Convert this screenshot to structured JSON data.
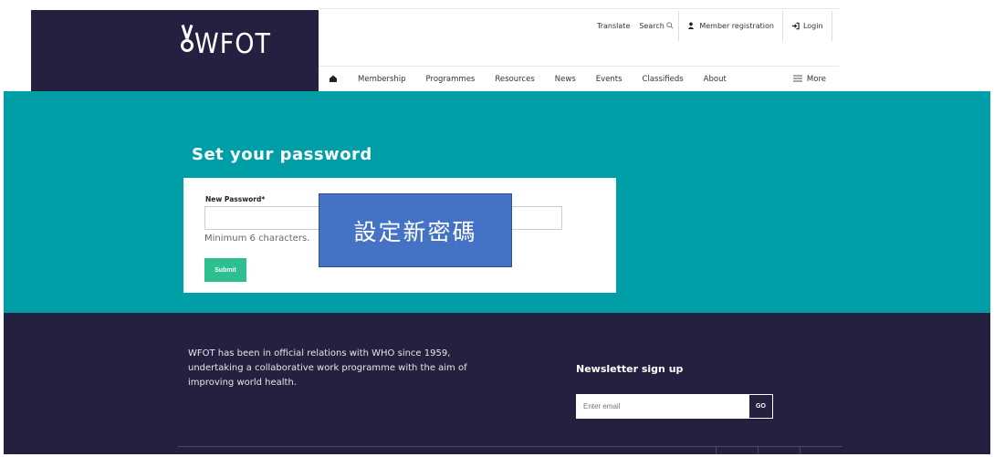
{
  "header": {
    "logo_text": "WFOT",
    "utility": {
      "translate": "Translate",
      "search": "Search",
      "member_registration": "Member registration",
      "login": "Login"
    },
    "nav": [
      "Membership",
      "Programmes",
      "Resources",
      "News",
      "Events",
      "Classifieds",
      "About"
    ],
    "more": "More"
  },
  "form": {
    "heading": "Set your password",
    "password_label": "New Password*",
    "password_value": "",
    "hint": "Minimum 6 characters.",
    "submit_label": "Submit"
  },
  "overlay": {
    "text": "設定新密碼"
  },
  "footer": {
    "about": "WFOT has been in official relations with WHO since 1959, undertaking a collaborative work programme with the aim of improving world health.",
    "newsletter_title": "Newsletter sign up",
    "email_placeholder": "Enter email",
    "go_label": "GO"
  },
  "colors": {
    "brand_dark": "#24203f",
    "teal": "#009ea6",
    "submit_green": "#2ebf91",
    "overlay_blue": "#4472c4"
  }
}
